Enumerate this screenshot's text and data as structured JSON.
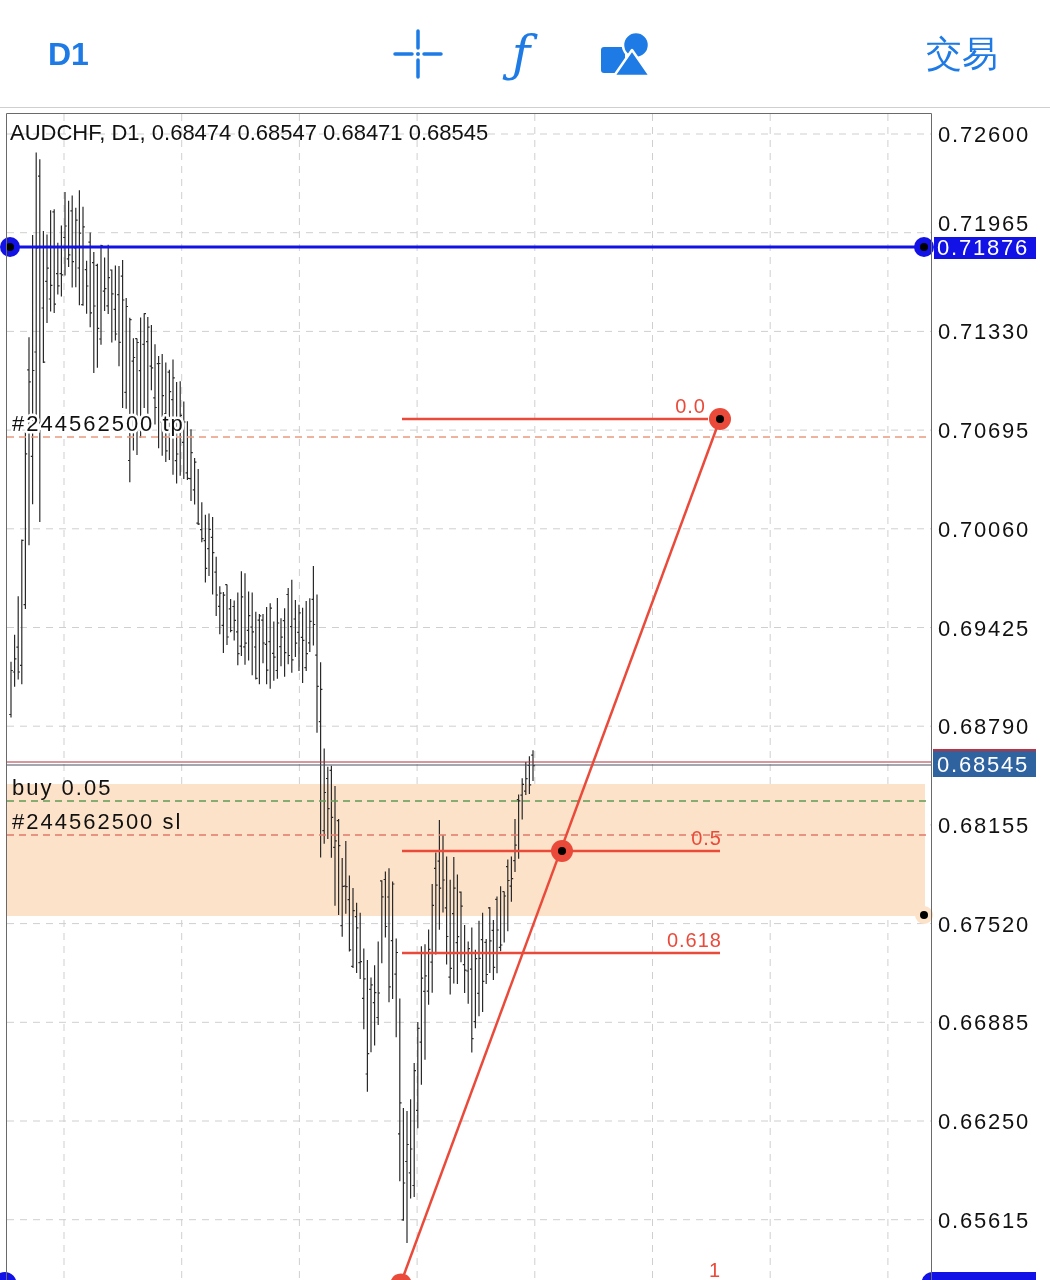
{
  "toolbar": {
    "timeframe": "D1",
    "indicators": "ƒ",
    "trade_button": "交易"
  },
  "chart": {
    "legend": "AUDCHF, D1, 0.68474 0.68547 0.68471 0.68545",
    "price_axis": {
      "labels": [
        "0.72600",
        "0.71965",
        "0.71330",
        "0.70695",
        "0.70060",
        "0.69425",
        "0.68790",
        "0.68155",
        "0.67520",
        "0.66885",
        "0.66250",
        "0.65615"
      ]
    },
    "horizontal_line": {
      "price_tag": "0.71876"
    },
    "current_price": {
      "price_tag": "0.68545"
    },
    "order_lines": [
      {
        "kind": "take_profit",
        "label": "#244562500 tp"
      },
      {
        "kind": "entry",
        "label": "buy 0.05"
      },
      {
        "kind": "stop_loss",
        "label": "#244562500 sl"
      }
    ],
    "fibonacci": {
      "levels": [
        {
          "label": "0.0"
        },
        {
          "label": "0.5"
        },
        {
          "label": "0.618"
        },
        {
          "label": "1"
        }
      ]
    }
  }
}
